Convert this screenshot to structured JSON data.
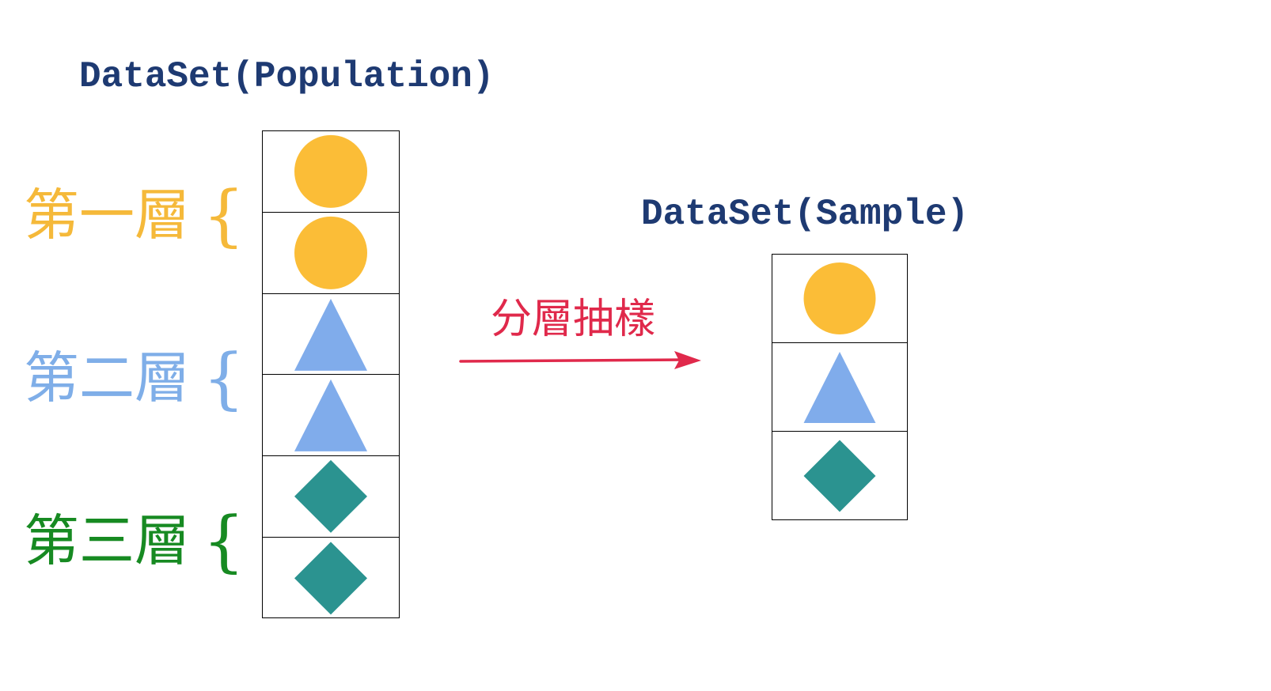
{
  "population": {
    "title": "DataSet(Population)",
    "cells": [
      "circle",
      "circle",
      "triangle",
      "triangle",
      "diamond",
      "diamond"
    ]
  },
  "sample": {
    "title": "DataSet(Sample)",
    "cells": [
      "circle",
      "triangle",
      "diamond"
    ]
  },
  "layers": [
    {
      "label": "第一層",
      "brace": "{",
      "color": "#f5b93a"
    },
    {
      "label": "第二層",
      "brace": "{",
      "color": "#7faee8"
    },
    {
      "label": "第三層",
      "brace": "{",
      "color": "#178a22"
    }
  ],
  "arrow": {
    "label": "分層抽樣",
    "color": "#e0294b"
  },
  "colors": {
    "circle": "#fbbd37",
    "triangle": "#80aceb",
    "diamond": "#2b9390",
    "title": "#1e3a72"
  }
}
